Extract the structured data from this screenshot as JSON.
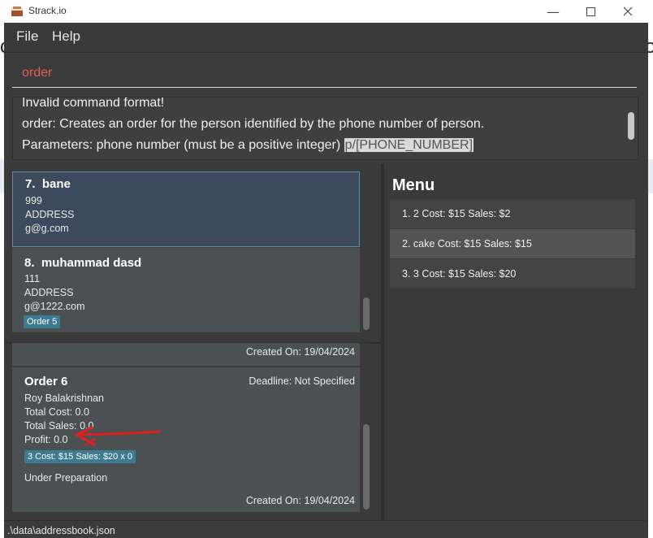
{
  "window": {
    "title": "Strack.io"
  },
  "menubar": {
    "file": "File",
    "help": "Help"
  },
  "command": {
    "value": "order"
  },
  "result": {
    "line1": "Invalid command format!",
    "line2": "order: Creates an order for the person identified by the phone number of person.",
    "line3_prefix": "Parameters: phone number (must be a positive integer) ",
    "line3_highlight": "p/[PHONE_NUMBER]"
  },
  "persons": [
    {
      "index": "7.",
      "name": "bane",
      "phone": "999",
      "address": "ADDRESS",
      "email": "g@g.com"
    },
    {
      "index": "8.",
      "name": "muhammad dasd",
      "phone": "111",
      "address": "ADDRESS",
      "email": "g@1222.com",
      "tag": "Order 5"
    }
  ],
  "orders": {
    "previous_created": "Created On: 19/04/2024",
    "current": {
      "title": "Order 6",
      "deadline": "Deadline: Not Specified",
      "customer": "Roy Balakrishnan",
      "total_cost": "Total Cost: 0.0",
      "total_sales": "Total Sales: 0.0",
      "profit": "Profit: 0.0",
      "item_tag": "3 Cost: $15 Sales: $20 x 0",
      "status": "Under Preparation",
      "created": "Created On: 19/04/2024"
    }
  },
  "menu": {
    "title": "Menu",
    "items": [
      "1. 2  Cost: $15  Sales: $2",
      "2. cake  Cost: $15  Sales: $15",
      "3. 3  Cost: $15  Sales: $20"
    ]
  },
  "statusbar": {
    "path": ".\\data\\addressbook.json"
  },
  "colors": {
    "accent_tag": "#3e7b91",
    "command_text": "#e0604a",
    "annotation_arrow": "#e02020"
  }
}
